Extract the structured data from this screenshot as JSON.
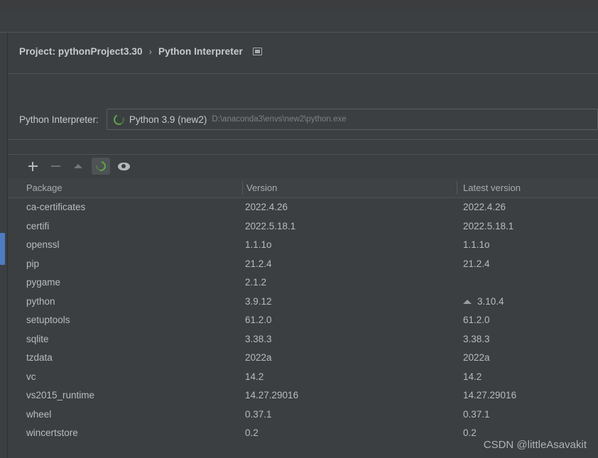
{
  "breadcrumb": {
    "project_label": "Project: pythonProject3.30",
    "separator": "›",
    "section_label": "Python Interpreter",
    "module_icon": "module-icon"
  },
  "interpreter": {
    "label": "Python Interpreter:",
    "icon": "python-env-icon",
    "name": "Python 3.9 (new2)",
    "path": "D:\\anaconda3\\envs\\new2\\python.exe"
  },
  "toolbar": {
    "buttons": [
      {
        "name": "add-package-button",
        "icon": "plus-icon",
        "enabled": true,
        "toggled": false
      },
      {
        "name": "remove-package-button",
        "icon": "minus-icon",
        "enabled": false,
        "toggled": false
      },
      {
        "name": "upgrade-package-button",
        "icon": "up-arrow-icon",
        "enabled": false,
        "toggled": false
      },
      {
        "name": "refresh-button",
        "icon": "refresh-ring-icon",
        "enabled": true,
        "toggled": true
      },
      {
        "name": "show-early-releases-button",
        "icon": "eye-icon",
        "enabled": true,
        "toggled": false
      }
    ]
  },
  "table": {
    "columns": [
      "Package",
      "Version",
      "Latest version"
    ],
    "rows": [
      {
        "package": "ca-certificates",
        "version": "2022.4.26",
        "latest": "2022.4.26",
        "upgradable": false
      },
      {
        "package": "certifi",
        "version": "2022.5.18.1",
        "latest": "2022.5.18.1",
        "upgradable": false
      },
      {
        "package": "openssl",
        "version": "1.1.1o",
        "latest": "1.1.1o",
        "upgradable": false
      },
      {
        "package": "pip",
        "version": "21.2.4",
        "latest": "21.2.4",
        "upgradable": false
      },
      {
        "package": "pygame",
        "version": "2.1.2",
        "latest": "",
        "upgradable": false
      },
      {
        "package": "python",
        "version": "3.9.12",
        "latest": "3.10.4",
        "upgradable": true
      },
      {
        "package": "setuptools",
        "version": "61.2.0",
        "latest": "61.2.0",
        "upgradable": false
      },
      {
        "package": "sqlite",
        "version": "3.38.3",
        "latest": "3.38.3",
        "upgradable": false
      },
      {
        "package": "tzdata",
        "version": "2022a",
        "latest": "2022a",
        "upgradable": false
      },
      {
        "package": "vc",
        "version": "14.2",
        "latest": "14.2",
        "upgradable": false
      },
      {
        "package": "vs2015_runtime",
        "version": "14.27.29016",
        "latest": "14.27.29016",
        "upgradable": false
      },
      {
        "package": "wheel",
        "version": "0.37.1",
        "latest": "0.37.1",
        "upgradable": false
      },
      {
        "package": "wincertstore",
        "version": "0.2",
        "latest": "0.2",
        "upgradable": false
      }
    ]
  },
  "watermark": {
    "text": "CSDN @littleAsavakit"
  },
  "colors": {
    "panel_bg": "#3c3f41",
    "window_bg": "#313335",
    "chrome_bg": "#3b3d3f",
    "text": "#b9bcbe",
    "muted_text": "#7e8183",
    "divider": "#4e5254",
    "accent_green": "#5ba845",
    "scrollbar_blue": "#4e7cc4"
  }
}
